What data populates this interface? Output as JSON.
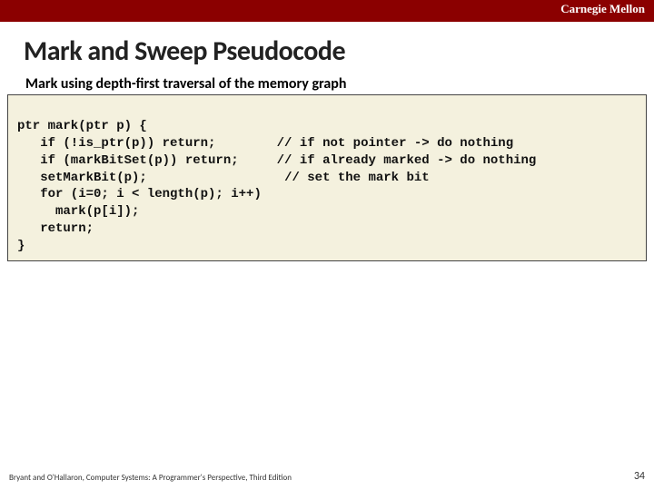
{
  "header": {
    "institution": "Carnegie Mellon"
  },
  "title": "Mark and Sweep Pseudocode",
  "subtitle": "Mark using depth-first traversal of the memory graph",
  "code": {
    "l1a": "ptr mark(ptr p) {",
    "l2a": "   if (!is_ptr(p)) return;",
    "l2c": "// if not pointer -> do nothing",
    "l3a": "   if (markBitSet(p)) return;",
    "l3c": "// if already marked -> do nothing",
    "l4a": "   setMarkBit(p);",
    "l4c": "// set the mark bit",
    "l5a": "   for (i=0; i < length(p); i++)",
    "l6a": "     mark(p[i]);",
    "l7a": "   return;",
    "l8a": "}"
  },
  "footer": {
    "attribution": "Bryant and O'Hallaron, Computer Systems: A Programmer's Perspective, Third Edition",
    "page": "34"
  }
}
